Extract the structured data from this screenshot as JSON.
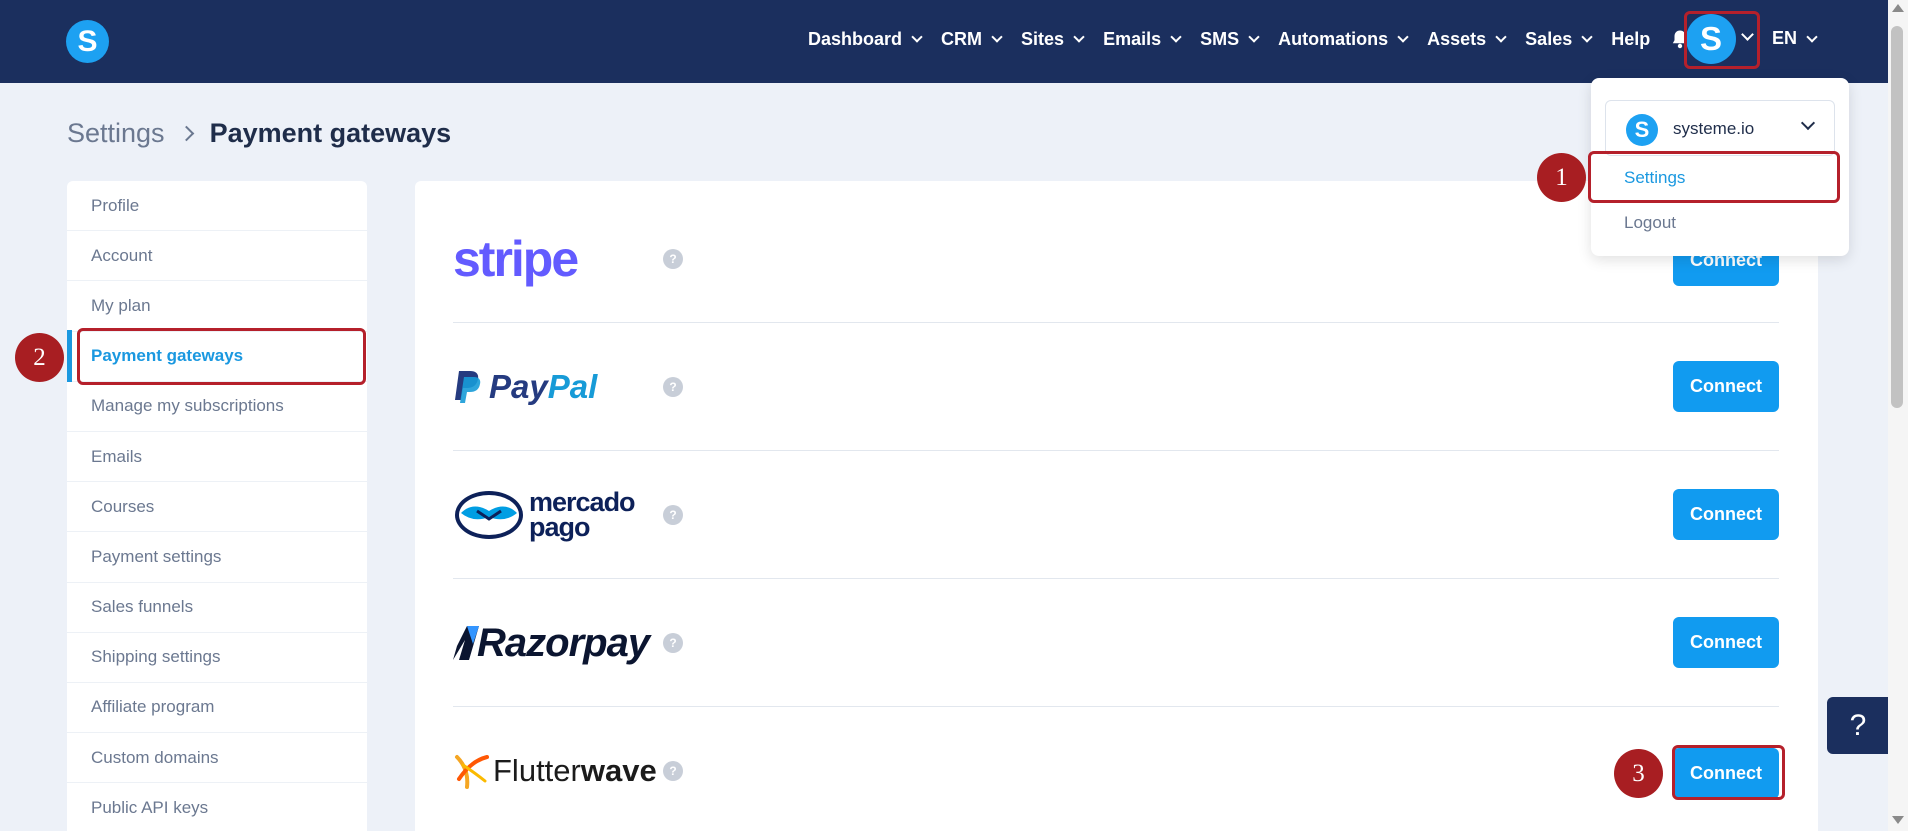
{
  "header": {
    "logo_letter": "S",
    "nav": [
      {
        "label": "Dashboard",
        "has_dropdown": true
      },
      {
        "label": "CRM",
        "has_dropdown": true
      },
      {
        "label": "Sites",
        "has_dropdown": true
      },
      {
        "label": "Emails",
        "has_dropdown": true
      },
      {
        "label": "SMS",
        "has_dropdown": true
      },
      {
        "label": "Automations",
        "has_dropdown": true
      },
      {
        "label": "Assets",
        "has_dropdown": true
      },
      {
        "label": "Sales",
        "has_dropdown": true
      },
      {
        "label": "Help",
        "has_dropdown": false
      }
    ],
    "bell_icon": "bell-icon",
    "avatar_letter": "S",
    "language": "EN"
  },
  "breadcrumb": {
    "root": "Settings",
    "current": "Payment gateways"
  },
  "sidebar": {
    "items": [
      {
        "label": "Profile",
        "active": false
      },
      {
        "label": "Account",
        "active": false
      },
      {
        "label": "My plan",
        "active": false
      },
      {
        "label": "Payment gateways",
        "active": true
      },
      {
        "label": "Manage my subscriptions",
        "active": false
      },
      {
        "label": "Emails",
        "active": false
      },
      {
        "label": "Courses",
        "active": false
      },
      {
        "label": "Payment settings",
        "active": false
      },
      {
        "label": "Sales funnels",
        "active": false
      },
      {
        "label": "Shipping settings",
        "active": false
      },
      {
        "label": "Affiliate program",
        "active": false
      },
      {
        "label": "Custom domains",
        "active": false
      },
      {
        "label": "Public API keys",
        "active": false
      }
    ]
  },
  "gateways": {
    "stripe": {
      "logo_text": "stripe",
      "button": "Connect"
    },
    "paypal": {
      "logo_text_a": "Pay",
      "logo_text_b": "Pal",
      "button": "Connect"
    },
    "mercadopago": {
      "logo_line1": "mercado",
      "logo_line2": "pago",
      "button": "Connect"
    },
    "razorpay": {
      "logo_text": "Razorpay",
      "button": "Connect"
    },
    "flutterwave": {
      "logo_text_a": "Flutter",
      "logo_text_b": "wave",
      "button": "Connect"
    },
    "help_symbol": "?"
  },
  "dropdown": {
    "account_letter": "S",
    "account_name": "systeme.io",
    "settings": "Settings",
    "logout": "Logout"
  },
  "annotations": {
    "marker_1": "1",
    "marker_2": "2",
    "marker_3": "3"
  },
  "help_widget": "?",
  "colors": {
    "nav_bg": "#1b2f5e",
    "accent": "#1a98e0",
    "button": "#119bf0",
    "highlight": "#b5202b",
    "marker": "#a81e22"
  }
}
